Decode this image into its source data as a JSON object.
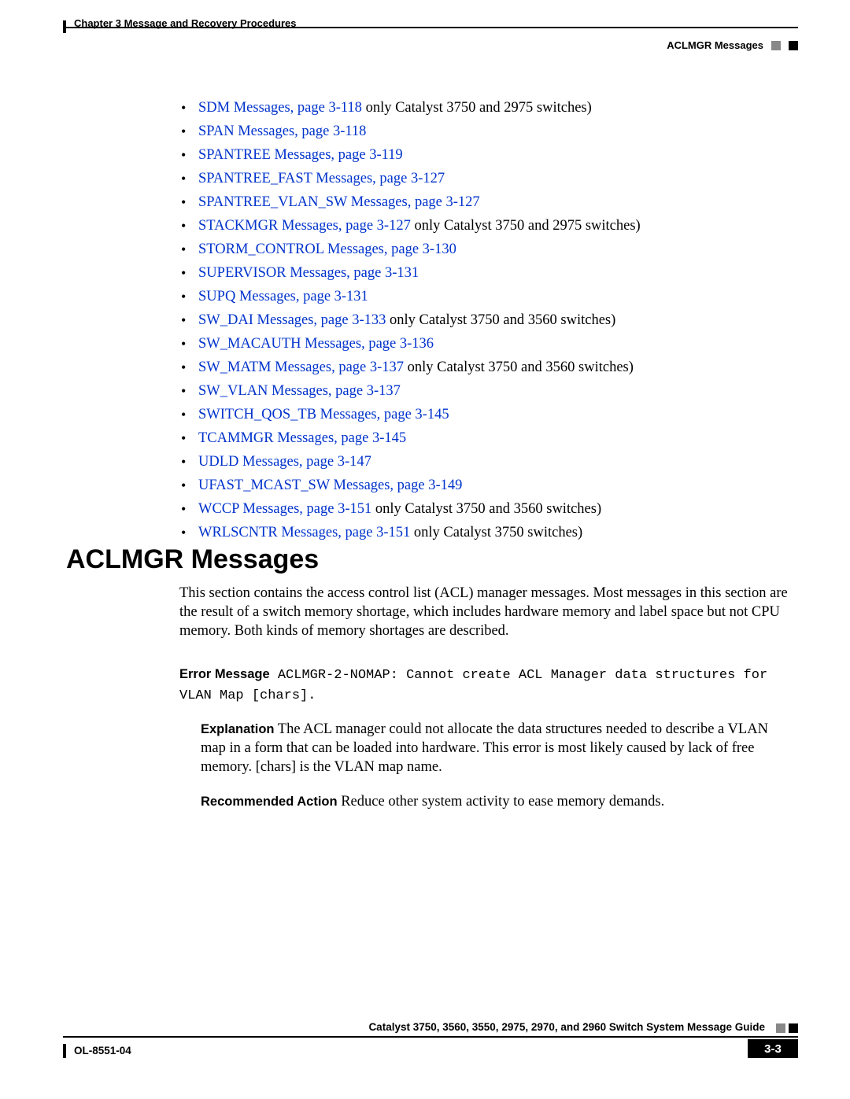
{
  "header": {
    "chapter_label": "Chapter 3      Message and Recovery Procedures",
    "section_label": "ACLMGR Messages"
  },
  "toc": [
    {
      "link": "SDM Messages, page 3-118",
      "extra": " only Catalyst 3750 and 2975 switches)"
    },
    {
      "link": "SPAN Messages, page 3-118",
      "extra": ""
    },
    {
      "link": "SPANTREE Messages, page 3-119",
      "extra": ""
    },
    {
      "link": "SPANTREE_FAST Messages, page 3-127",
      "extra": ""
    },
    {
      "link": "SPANTREE_VLAN_SW Messages, page 3-127",
      "extra": ""
    },
    {
      "link": "STACKMGR Messages, page 3-127",
      "extra": " only Catalyst 3750 and 2975 switches)"
    },
    {
      "link": "STORM_CONTROL Messages, page 3-130",
      "extra": ""
    },
    {
      "link": "SUPERVISOR Messages, page 3-131",
      "extra": ""
    },
    {
      "link": "SUPQ Messages, page 3-131",
      "extra": ""
    },
    {
      "link": "SW_DAI Messages, page 3-133",
      "extra": " only Catalyst 3750 and 3560 switches)"
    },
    {
      "link": "SW_MACAUTH Messages, page 3-136",
      "extra": ""
    },
    {
      "link": "SW_MATM Messages, page 3-137",
      "extra": " only Catalyst 3750 and 3560 switches)"
    },
    {
      "link": "SW_VLAN Messages, page 3-137",
      "extra": ""
    },
    {
      "link": "SWITCH_QOS_TB Messages, page 3-145",
      "extra": ""
    },
    {
      "link": "TCAMMGR Messages, page 3-145",
      "extra": ""
    },
    {
      "link": "UDLD Messages, page 3-147",
      "extra": ""
    },
    {
      "link": "UFAST_MCAST_SW Messages, page 3-149",
      "extra": ""
    },
    {
      "link": "WCCP Messages, page 3-151",
      "extra": " only Catalyst 3750 and 3560 switches)"
    },
    {
      "link": "WRLSCNTR Messages, page 3-151",
      "extra": " only Catalyst 3750 switches)"
    }
  ],
  "section": {
    "heading": "ACLMGR Messages",
    "intro": "This section contains the access control list (ACL) manager messages. Most messages in this section are the result of a switch memory shortage, which includes hardware memory and label space but not CPU memory. Both kinds of memory shortages are described.",
    "error_label": "Error Message",
    "error_code": "   ACLMGR-2-NOMAP: Cannot create ACL Manager data structures for VLAN Map [chars].",
    "explanation_label": "Explanation",
    "explanation_text": "    The ACL manager could not allocate the data structures needed to describe a VLAN map in a form that can be loaded into hardware. This error is most likely caused by lack of free memory. [chars] is the VLAN map name.",
    "recommended_label": "Recommended Action",
    "recommended_text": "    Reduce other system activity to ease memory demands."
  },
  "footer": {
    "book_title": "Catalyst 3750, 3560, 3550, 2975, 2970, and 2960 Switch System Message Guide",
    "doc_id": "OL-8551-04",
    "page": "3-3"
  }
}
